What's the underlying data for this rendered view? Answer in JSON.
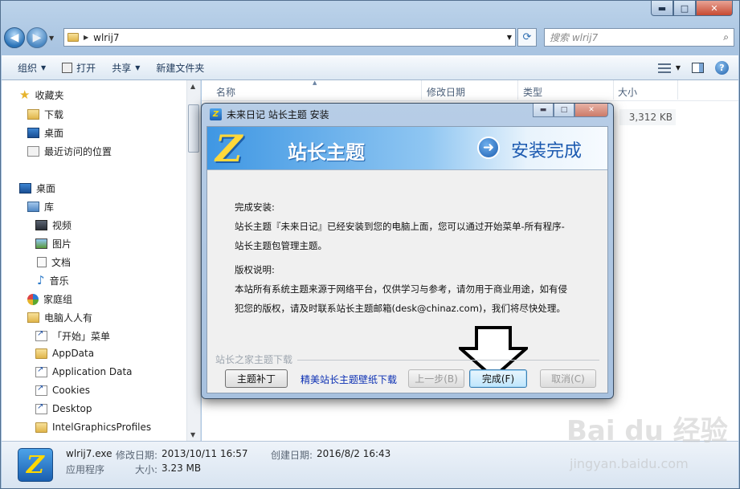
{
  "window": {
    "minimize": "▬",
    "maximize": "□",
    "close": "✕"
  },
  "address": {
    "path": "wlrij7",
    "search_placeholder": "搜索 wlrij7"
  },
  "toolbar": {
    "organize": "组织",
    "open": "打开",
    "share": "共享",
    "new_folder": "新建文件夹"
  },
  "sidebar": {
    "favorites": "收藏夹",
    "downloads": "下载",
    "desktop_fav": "桌面",
    "recent": "最近访问的位置",
    "desktop": "桌面",
    "libraries": "库",
    "videos": "视频",
    "pictures": "图片",
    "documents": "文档",
    "music": "音乐",
    "homegroup": "家庭组",
    "user": "电脑人人有",
    "start_menu": "「开始」菜单",
    "appdata": "AppData",
    "application_data": "Application Data",
    "cookies": "Cookies",
    "desktop_en": "Desktop",
    "intel": "IntelGraphicsProfiles"
  },
  "filelist": {
    "col_name": "名称",
    "col_date": "修改日期",
    "col_type": "类型",
    "col_size": "大小",
    "file_size": "3,312 KB"
  },
  "status": {
    "filename": "wlrij7.exe",
    "modified_label": "修改日期:",
    "modified_value": "2013/10/11 16:57",
    "created_label": "创建日期:",
    "created_value": "2016/8/2 16:43",
    "type": "应用程序",
    "size_label": "大小:",
    "size_value": "3.23 MB"
  },
  "watermark": {
    "brand": "Bai du 经验",
    "url": "jingyan.baidu.com"
  },
  "dialog": {
    "title": "未来日记 站长主题 安装",
    "banner_logo": "Z",
    "banner_brand": "站长主题",
    "banner_status": "安装完成",
    "line1": "完成安装:",
    "line2": "站长主题『未来日记』已经安装到您的电脑上面，您可以通过开始菜单-所有程序-",
    "line3": "站长主题包管理主题。",
    "line4": "版权说明:",
    "line5": "本站所有系统主题来源于网络平台，仅供学习与参考，请勿用于商业用途，如有侵",
    "line6": "犯您的版权，请及时联系站长主题邮箱(desk@chinaz.com)，我们将尽快处理。",
    "group_label": "站长之家主题下载",
    "patch_button": "主题补丁",
    "wallpaper_link": "精美站长主题壁纸下载",
    "back_button": "上一步(B)",
    "finish_button": "完成(F)",
    "cancel_button": "取消(C)"
  }
}
